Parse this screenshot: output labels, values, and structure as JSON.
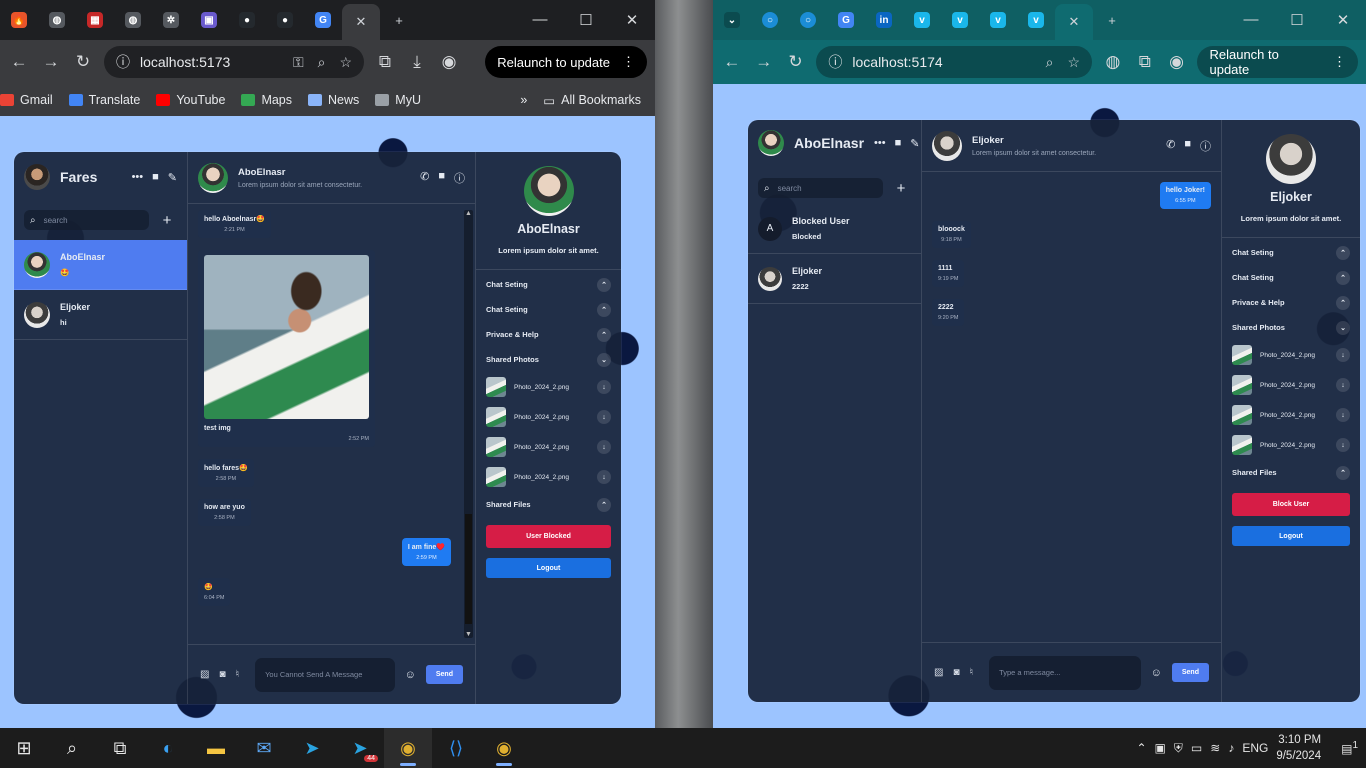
{
  "left_browser": {
    "tabs": [
      {
        "icon": "fire-icon",
        "color": "#e8542a"
      },
      {
        "icon": "globe-icon",
        "color": "#6b6f75"
      },
      {
        "icon": "site-icon",
        "color": "#c62828"
      },
      {
        "icon": "globe-icon",
        "color": "#6b6f75"
      },
      {
        "icon": "openai-icon",
        "color": "#6b6f75"
      },
      {
        "icon": "app-icon",
        "color": "#6a5acd"
      },
      {
        "icon": "github-icon",
        "color": "#24292e"
      },
      {
        "icon": "github-icon",
        "color": "#24292e"
      },
      {
        "icon": "translate-icon",
        "color": "#4285f4"
      }
    ],
    "url": "localhost:5173",
    "relaunch": "Relaunch to update",
    "bookmarks": [
      "Gmail",
      "Translate",
      "YouTube",
      "Maps",
      "News",
      "MyU"
    ],
    "all_bookmarks": "All Bookmarks"
  },
  "right_browser": {
    "url": "localhost:5174",
    "relaunch": "Relaunch to update"
  },
  "left_app": {
    "user": "Fares",
    "search_placeholder": "search",
    "chats": [
      {
        "name": "AboElnasr",
        "last": "🤩"
      },
      {
        "name": "Eljoker",
        "last": "hi"
      }
    ],
    "chat": {
      "name": "AboElnasr",
      "desc": "Lorem ipsum dolor sit amet consectetur.",
      "messages": [
        {
          "text": "hello Aboelnasr🤩",
          "time": "2:21 PM"
        },
        {
          "text": "test img",
          "time": "2:52 PM",
          "image": true
        },
        {
          "text": "hello fares🤩",
          "time": "2:58 PM"
        },
        {
          "text": "how are yuo",
          "time": "2:58 PM"
        },
        {
          "text": "I am fine♥️",
          "time": "2:59 PM",
          "own": true
        },
        {
          "text": "🤩",
          "time": "6:04 PM"
        }
      ],
      "input_placeholder": "You Cannot Send A Message",
      "send": "Send"
    },
    "detail": {
      "name": "AboElnasr",
      "desc": "Lorem ipsum dolor sit amet.",
      "options": [
        "Chat Seting",
        "Chat Seting",
        "Privace & Help",
        "Shared Photos"
      ],
      "photos": [
        "Photo_2024_2.png",
        "Photo_2024_2.png",
        "Photo_2024_2.png",
        "Photo_2024_2.png"
      ],
      "shared_files": "Shared Files",
      "block": "User Blocked",
      "logout": "Logout"
    }
  },
  "right_app": {
    "user": "AboElnasr",
    "search_placeholder": "search",
    "chats": [
      {
        "name": "Blocked User",
        "last": "Blocked",
        "letter": "A"
      },
      {
        "name": "Eljoker",
        "last": "2222"
      }
    ],
    "chat": {
      "name": "Eljoker",
      "desc": "Lorem ipsum dolor sit amet consectetur.",
      "messages": [
        {
          "text": "hello Joker!",
          "time": "6:55 PM",
          "own": true
        },
        {
          "text": "blooock",
          "time": "9:18 PM"
        },
        {
          "text": "1111",
          "time": "9:19 PM"
        },
        {
          "text": "2222",
          "time": "9:20 PM"
        }
      ],
      "input_placeholder": "Type a message...",
      "send": "Send"
    },
    "detail": {
      "name": "Eljoker",
      "desc": "Lorem ipsum dolor sit amet.",
      "options": [
        "Chat Seting",
        "Chat Seting",
        "Privace & Help",
        "Shared Photos"
      ],
      "photos": [
        "Photo_2024_2.png",
        "Photo_2024_2.png",
        "Photo_2024_2.png",
        "Photo_2024_2.png"
      ],
      "shared_files": "Shared Files",
      "block": "Block User",
      "logout": "Logout"
    }
  },
  "taskbar": {
    "lang": "ENG",
    "time": "3:10 PM",
    "date": "9/5/2024",
    "telegram_badge": "44",
    "notifications": "1"
  }
}
